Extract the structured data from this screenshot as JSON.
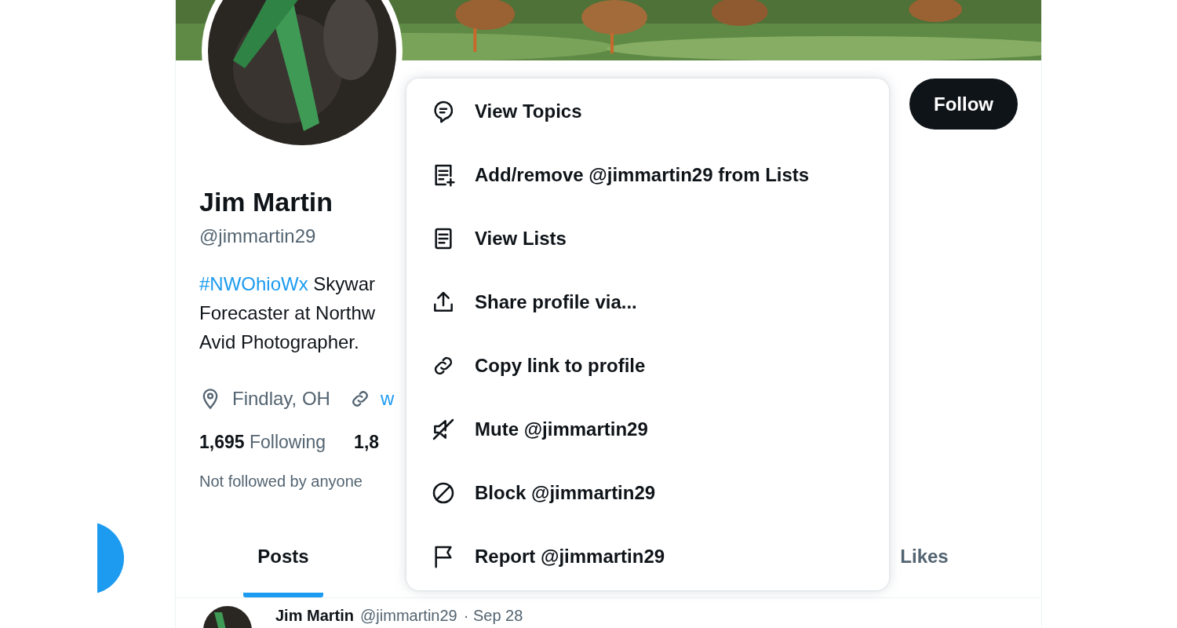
{
  "profile": {
    "name": "Jim Martin",
    "handle": "@jimmartin29",
    "bio": {
      "hashtag": "#NWOhioWx",
      "lines": [
        "Skywar",
        "Forecaster at Northw",
        "Avid Photographer."
      ]
    },
    "location": "Findlay, OH",
    "website": "w",
    "stats": [
      {
        "count": "1,695",
        "label": "Following"
      },
      {
        "count": "1,8"
      }
    ],
    "followed_by": "Not followed by anyone"
  },
  "follow_button": "Follow",
  "menu": [
    {
      "kind": "topics",
      "label": "View Topics"
    },
    {
      "kind": "list-add",
      "label": "Add/remove @jimmartin29 from Lists"
    },
    {
      "kind": "list",
      "label": "View Lists"
    },
    {
      "kind": "share",
      "label": "Share profile via..."
    },
    {
      "kind": "link",
      "label": "Copy link to profile"
    },
    {
      "kind": "mute",
      "label": "Mute @jimmartin29"
    },
    {
      "kind": "block",
      "label": "Block @jimmartin29"
    },
    {
      "kind": "report",
      "label": "Report @jimmartin29"
    }
  ],
  "tabs": [
    {
      "label": "Posts",
      "selected": true
    },
    {
      "label": "Likes",
      "selected": false
    }
  ],
  "post": {
    "name": "Jim Martin",
    "handle": "@jimmartin29",
    "time": "· Sep 28"
  }
}
